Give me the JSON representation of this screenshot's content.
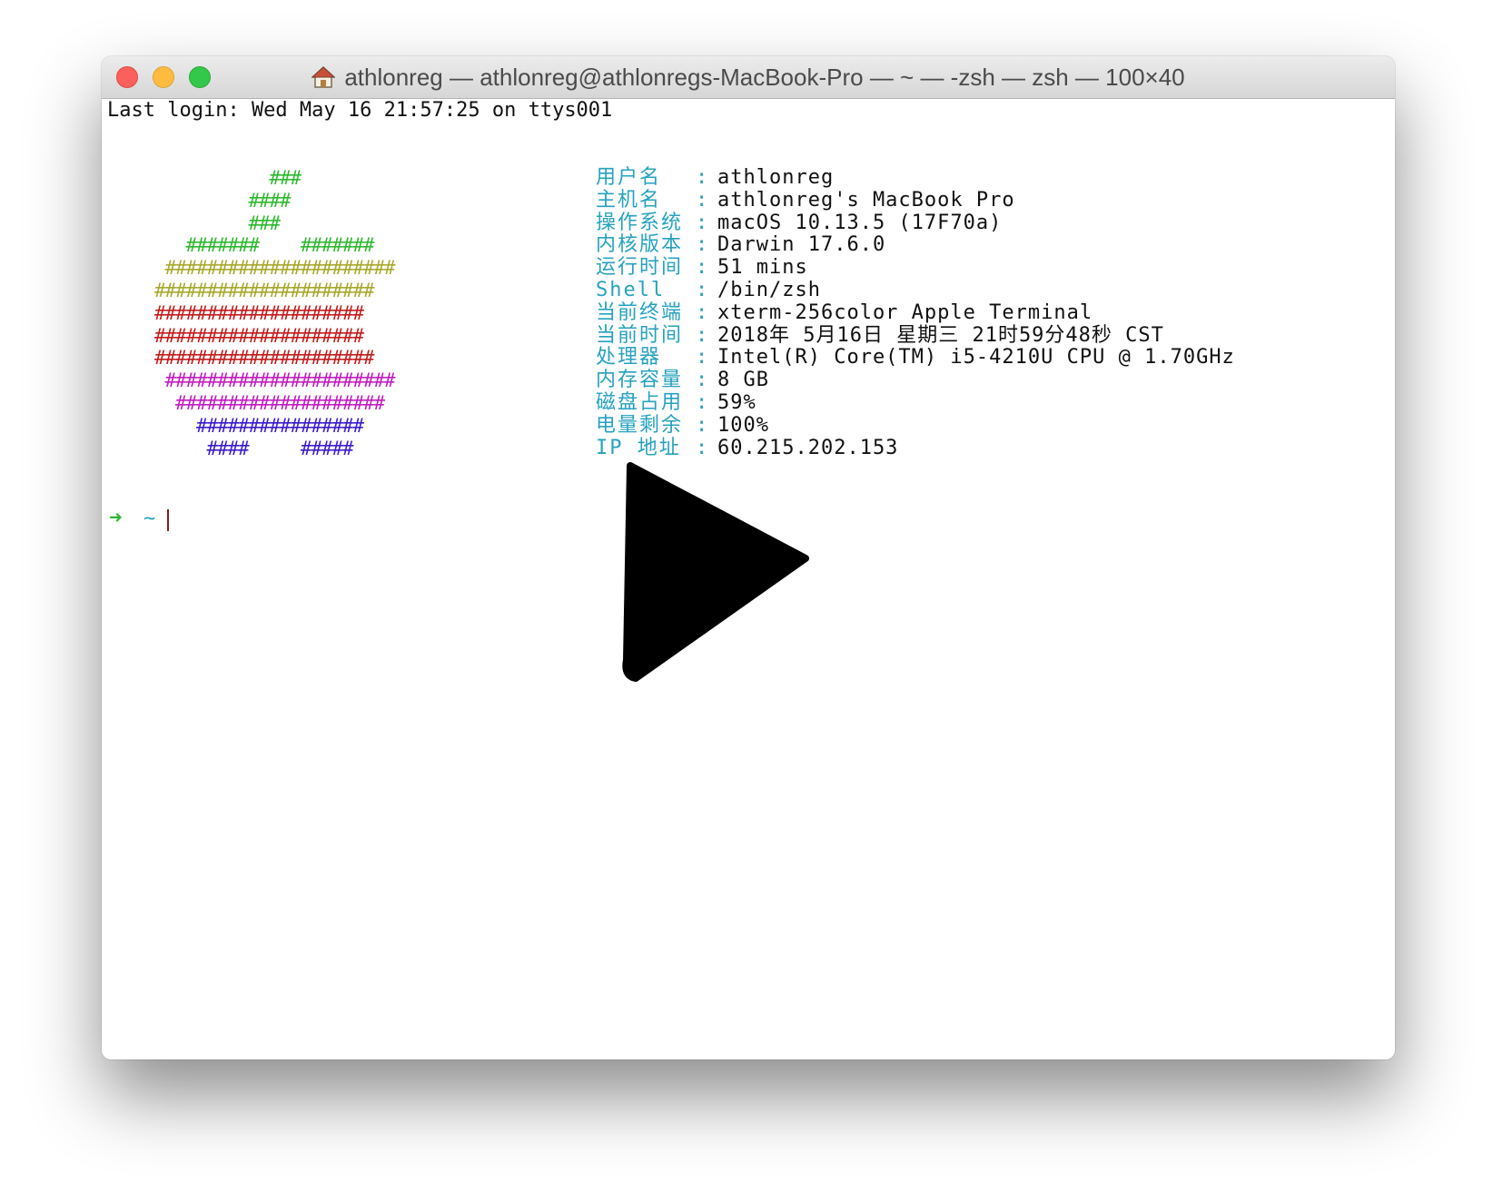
{
  "window": {
    "title": "athlonreg — athlonreg@athlonregs-MacBook-Pro — ~ — -zsh — zsh — 100×40",
    "title_icon": "home-icon",
    "traffic_lights": {
      "close_color": "#fc605c",
      "minimize_color": "#fdbc40",
      "maximize_color": "#34c84a"
    }
  },
  "terminal": {
    "last_login": "Last login: Wed May 16 21:57:25 on ttys001",
    "ascii_art": [
      {
        "text": "           ###",
        "color": "#2db92d"
      },
      {
        "text": "         ####",
        "color": "#2db92d"
      },
      {
        "text": "         ###",
        "color": "#2db92d"
      },
      {
        "text": "   #######    #######",
        "color": "#2db92d"
      },
      {
        "text": " ######################",
        "color": "#a8a82c"
      },
      {
        "text": "#####################",
        "color": "#a8a82c"
      },
      {
        "text": "####################",
        "color": "#c41a1a"
      },
      {
        "text": "####################",
        "color": "#c41a1a"
      },
      {
        "text": "#####################",
        "color": "#c41a1a"
      },
      {
        "text": " ######################",
        "color": "#c21ac2"
      },
      {
        "text": "  ####################",
        "color": "#c21ac2"
      },
      {
        "text": "    ################",
        "color": "#3a1ad0"
      },
      {
        "text": "     ####     #####",
        "color": "#3a1ad0"
      }
    ],
    "info": [
      {
        "label": "用户名",
        "value": "athlonreg"
      },
      {
        "label": "主机名",
        "value": "athlonreg's MacBook Pro"
      },
      {
        "label": "操作系统",
        "value": "macOS 10.13.5 (17F70a)"
      },
      {
        "label": "内核版本",
        "value": "Darwin 17.6.0"
      },
      {
        "label": "运行时间",
        "value": "51 mins"
      },
      {
        "label": "Shell",
        "value": "/bin/zsh"
      },
      {
        "label": "当前终端",
        "value": "xterm-256color Apple Terminal"
      },
      {
        "label": "当前时间",
        "value": "2018年 5月16日 星期三 21时59分48秒 CST"
      },
      {
        "label": "处理器",
        "value": "Intel(R) Core(TM) i5-4210U CPU @ 1.70GHz"
      },
      {
        "label": "内存容量",
        "value": "8 GB"
      },
      {
        "label": "磁盘占用",
        "value": "59%"
      },
      {
        "label": "电量剩余",
        "value": "100%"
      },
      {
        "label": "IP 地址",
        "value": "60.215.202.153"
      }
    ],
    "colon": ":",
    "prompt": {
      "arrow": "➜",
      "dir": "~"
    }
  },
  "overlay": {
    "icon": "play-icon",
    "color": "#000000"
  }
}
